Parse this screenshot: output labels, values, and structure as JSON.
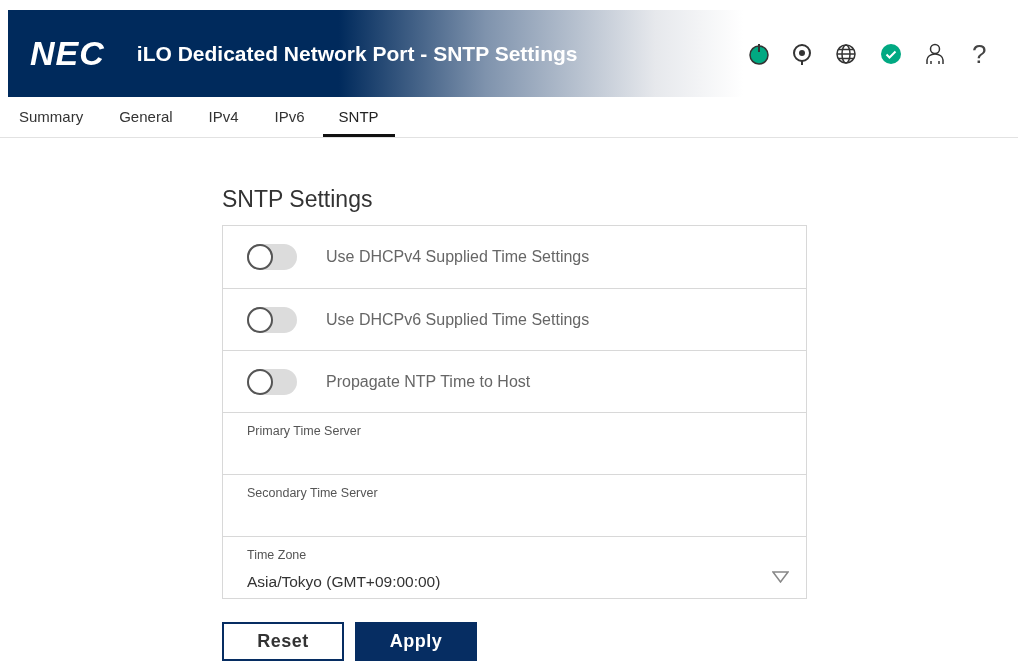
{
  "header": {
    "logo": "NEC",
    "title": "iLO Dedicated Network Port - SNTP Settings",
    "help": "?"
  },
  "tabs": [
    {
      "label": "Summary",
      "selected": false
    },
    {
      "label": "General",
      "selected": false
    },
    {
      "label": "IPv4",
      "selected": false
    },
    {
      "label": "IPv6",
      "selected": false
    },
    {
      "label": "SNTP",
      "selected": true
    }
  ],
  "heading": "SNTP Settings",
  "settings": [
    {
      "kind": "toggle",
      "label": "Use DHCPv4 Supplied Time Settings",
      "on": false
    },
    {
      "kind": "toggle",
      "label": "Use DHCPv6 Supplied Time Settings",
      "on": false
    },
    {
      "kind": "toggle",
      "label": "Propagate NTP Time to Host",
      "on": false
    },
    {
      "kind": "text",
      "label": "Primary Time Server"
    },
    {
      "kind": "text",
      "label": "Secondary Time Server"
    },
    {
      "kind": "select",
      "label": "Time Zone",
      "value": "Asia/Tokyo (GMT+09:00:00)"
    }
  ],
  "buttons": [
    {
      "label": "Reset",
      "kind": "secondary"
    },
    {
      "label": "Apply",
      "kind": "primary"
    }
  ]
}
